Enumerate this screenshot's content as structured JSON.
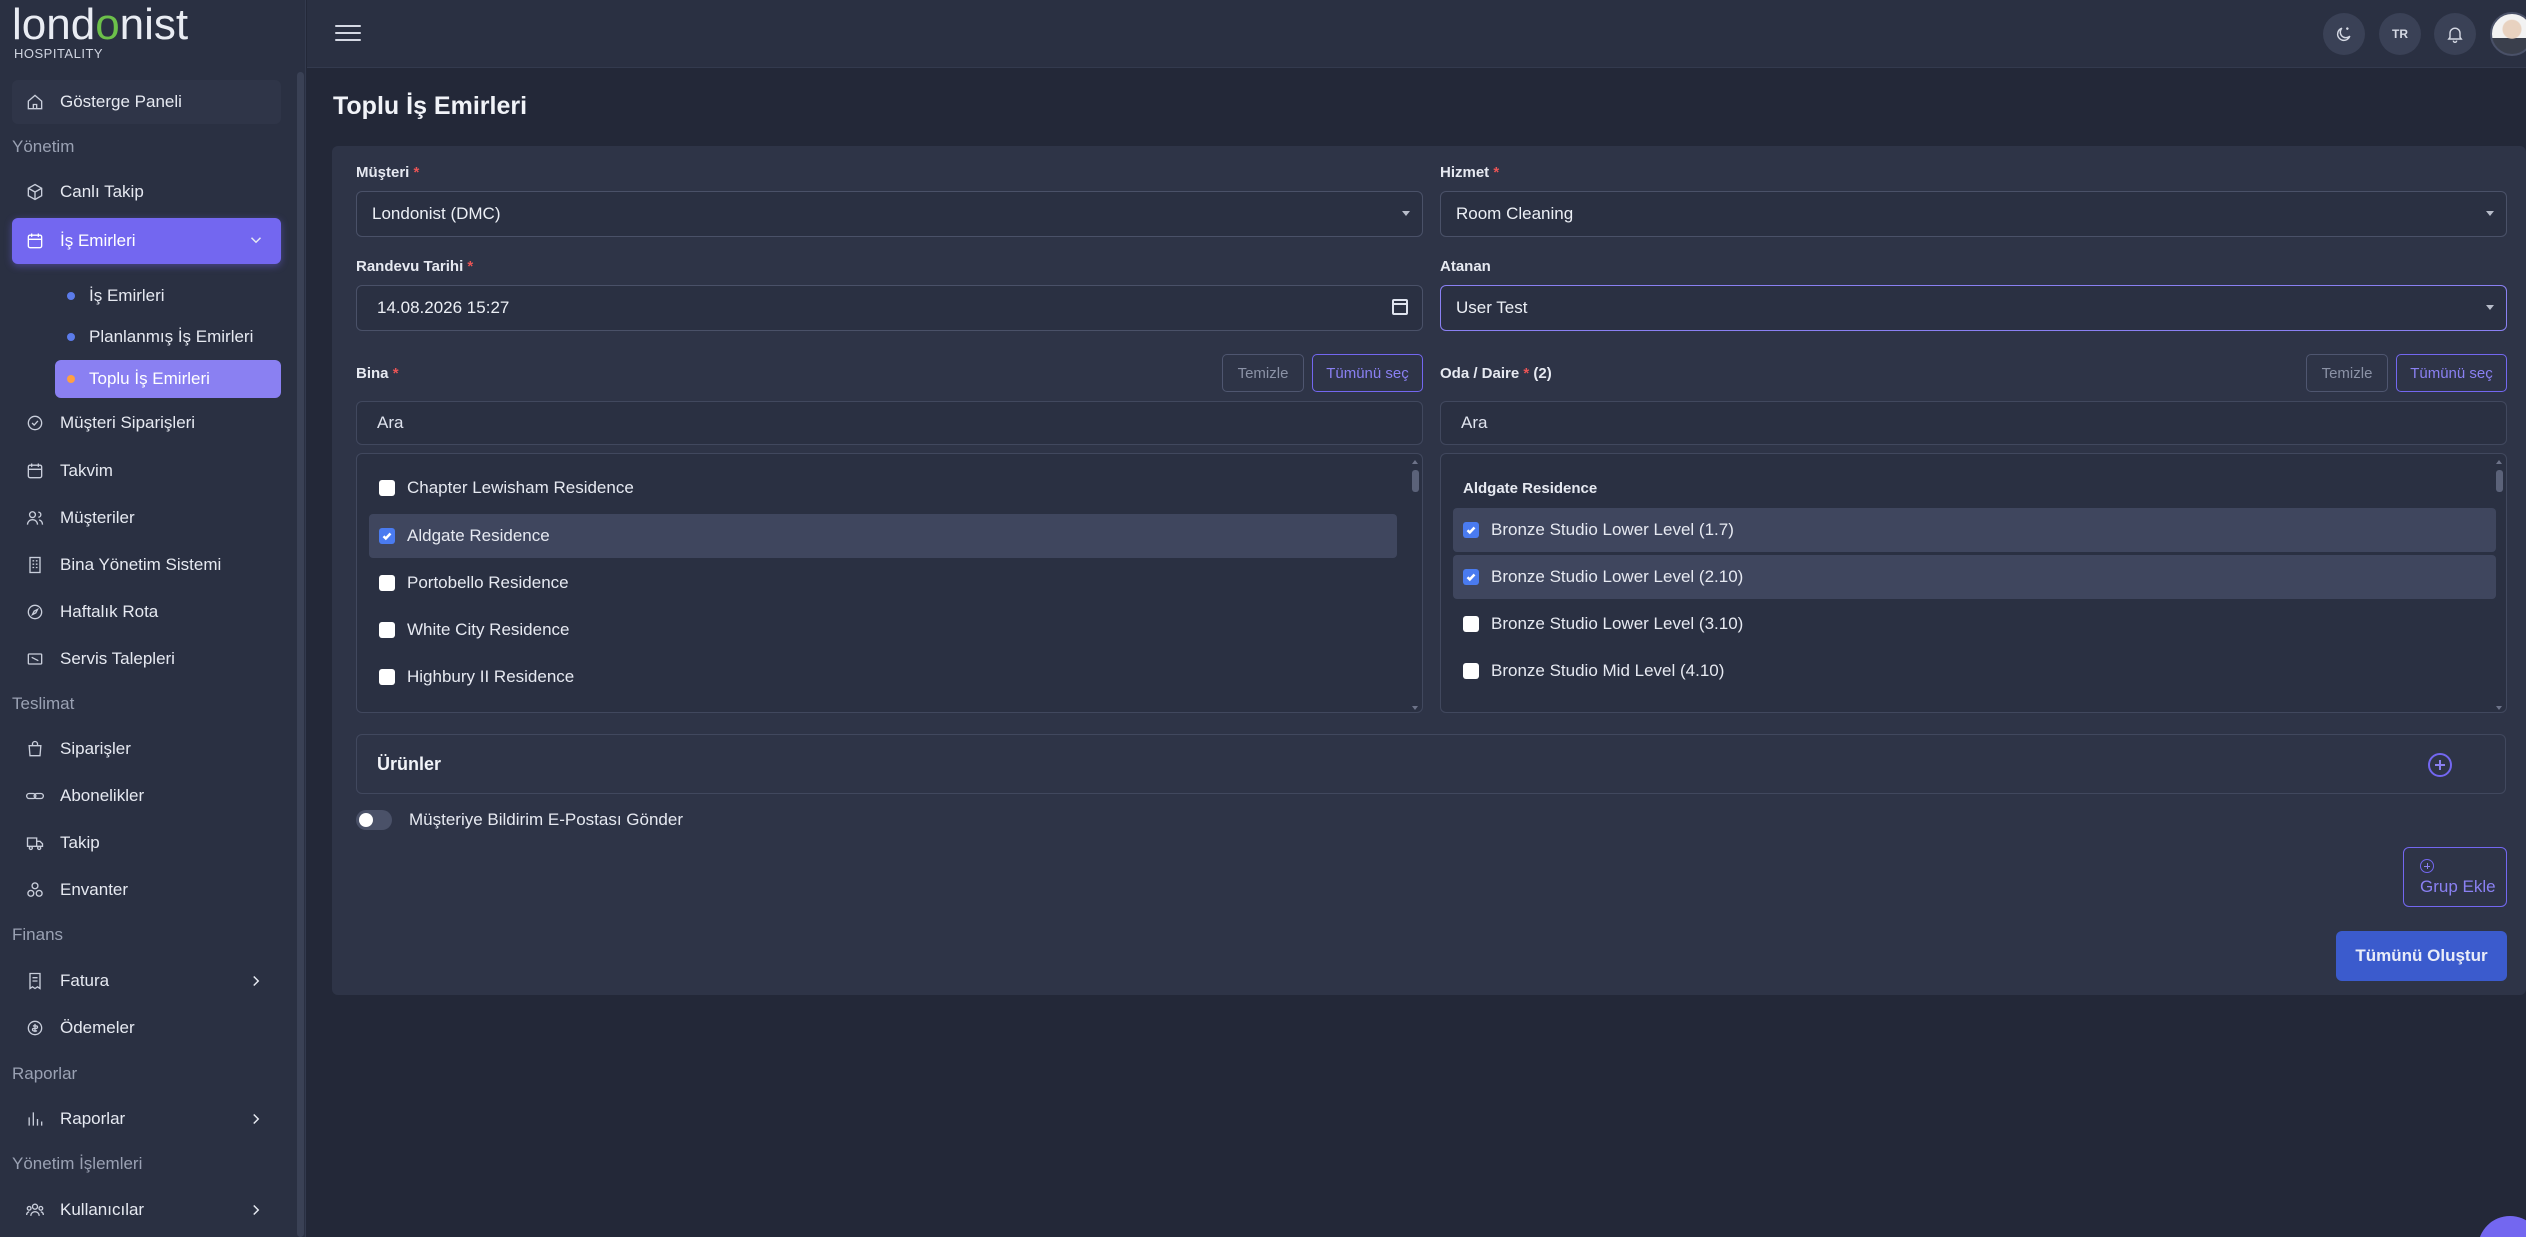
{
  "brand": {
    "name_part1": "lond",
    "name_leaf": "o",
    "name_part2": "nist",
    "sub": "HOSPITALITY"
  },
  "sidebar": {
    "home": "Gösterge Paneli",
    "sections": {
      "management": "Yönetim",
      "delivery": "Teslimat",
      "finance": "Finans",
      "reports": "Raporlar",
      "admin": "Yönetim İşlemleri"
    },
    "items": {
      "live": "Canlı Takip",
      "work_orders": "İş Emirleri",
      "sub_work_orders": "İş Emirleri",
      "sub_planned": "Planlanmış İş Emirleri",
      "sub_bulk": "Toplu İş Emirleri",
      "customer_orders": "Müşteri Siparişleri",
      "calendar": "Takvim",
      "customers": "Müşteriler",
      "building": "Bina Yönetim Sistemi",
      "weekly": "Haftalık Rota",
      "service": "Servis Talepleri",
      "orders": "Siparişler",
      "subscriptions": "Abonelikler",
      "tracking": "Takip",
      "inventory": "Envanter",
      "invoice": "Fatura",
      "payments": "Ödemeler",
      "reports": "Raporlar",
      "users": "Kullanıcılar"
    }
  },
  "topbar": {
    "lang": "TR"
  },
  "page": {
    "title": "Toplu İş Emirleri"
  },
  "form": {
    "customer": {
      "label": "Müşteri",
      "req": "*",
      "value": "Londonist (DMC)"
    },
    "service": {
      "label": "Hizmet",
      "req": "*",
      "value": "Room Cleaning"
    },
    "date": {
      "label": "Randevu Tarihi",
      "req": "*",
      "value": "14.08.2026 15:27"
    },
    "assignee": {
      "label": "Atanan",
      "value": "User Test"
    },
    "building": {
      "label": "Bina",
      "req": "*",
      "clear": "Temizle",
      "select_all": "Tümünü seç",
      "search": "Ara",
      "items": [
        {
          "label": "Chapter Lewisham Residence",
          "checked": false
        },
        {
          "label": "Aldgate Residence",
          "checked": true
        },
        {
          "label": "Portobello Residence",
          "checked": false
        },
        {
          "label": "White City Residence",
          "checked": false
        },
        {
          "label": "Highbury II Residence",
          "checked": false
        }
      ]
    },
    "room": {
      "label": "Oda / Daire",
      "req": "*",
      "count": "(2)",
      "clear": "Temizle",
      "select_all": "Tümünü seç",
      "search": "Ara",
      "group": "Aldgate Residence",
      "items": [
        {
          "label": "Bronze Studio Lower Level (1.7)",
          "checked": true
        },
        {
          "label": "Bronze Studio Lower Level (2.10)",
          "checked": true
        },
        {
          "label": "Bronze Studio Lower Level (3.10)",
          "checked": false
        },
        {
          "label": "Bronze Studio Mid Level (4.10)",
          "checked": false
        }
      ]
    },
    "products": "Ürünler",
    "notify": {
      "label": "Müşteriye Bildirim E-Postası Gönder",
      "on": false
    },
    "add_group": "Grup Ekle",
    "create_all": "Tümünü Oluştur"
  },
  "colors": {
    "accent": "#7367f0",
    "primary_button": "#3b5bcd",
    "required": "#ea5455",
    "checkbox": "#4a7bf0"
  }
}
